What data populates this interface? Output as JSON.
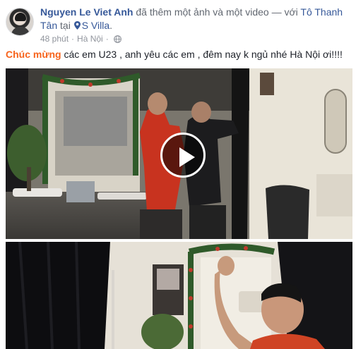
{
  "post": {
    "author": "Nguyen Le Viet Anh",
    "action_text": " đã thêm một ảnh và một video — với ",
    "tagged_friend": "Tô Thanh Tân",
    "at_text": " tại ",
    "location": "S Villa",
    "period": ".",
    "time": "48 phút",
    "separator": "·",
    "place": "Hà Nội",
    "separator2": "·"
  },
  "status": {
    "highlight": "Chúc mừng",
    "text": " các em U23 , anh yêu các em , đêm nay k ngủ nhé Hà Nội ơi!!!!"
  },
  "colors": {
    "link": "#365899",
    "highlight": "#f7631b",
    "meta": "#90949c"
  },
  "icons": [
    "location-pin-icon",
    "globe-icon",
    "play-icon"
  ]
}
